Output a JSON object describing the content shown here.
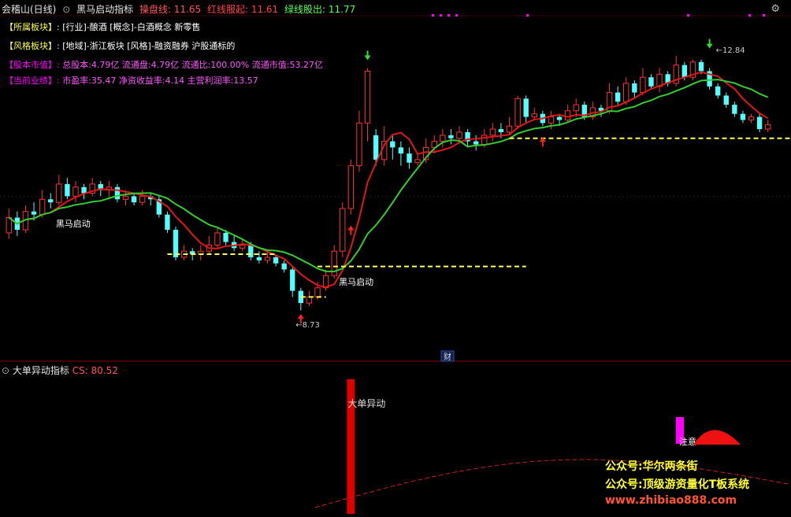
{
  "header": {
    "stock_name": "会稽山(日线)",
    "indicator_name": "黑马启动指标",
    "line1_label": "操盘线: 11.65",
    "line2_label": "红线服起: 11.61",
    "line3_label": "绿线股出: 11.77"
  },
  "info": {
    "row1_tag": "【所属板块】:",
    "row1_text": "[行业]-酿酒 [概念]-白酒概念 新零售",
    "row2_tag": "【风格板块】:",
    "row2_text": "[地域]-浙江板块 [风格]-融资融券 沪股通标的",
    "row3_tag": "【股本市值】:",
    "row3_text": "总股本:4.79亿 流通盘:4.79亿 流通比:100.00% 流通市值:53.27亿",
    "row4_tag": "【当前业绩】:",
    "row4_text": "市盈率:35.47 净资收益率:4.14 主营利润率:13.57"
  },
  "annotations": {
    "signal1": "黑马启动",
    "signal2": "黑马启动",
    "low_price": "8.73",
    "high_price": "12.84",
    "fin_marker": "财"
  },
  "sub_panel": {
    "title": "大单异动指标",
    "cs_label": "CS: 80.52",
    "spike_label": "大单异动",
    "attention_label": "注意"
  },
  "watermarks": {
    "line1": "公众号:华尔两条街",
    "line2": "公众号:顶级游资量化T板系统",
    "line3": "www.zhibiao888.com"
  },
  "colors": {
    "up": "#ff3333",
    "down": "#54ffff",
    "red_line": "#e01818",
    "green_line": "#33cc33",
    "yellow": "#ffff55",
    "magenta": "#ff00ff"
  },
  "chart_data": {
    "type": "candlestick",
    "price_range": [
      8.4,
      13.3
    ],
    "candles": [
      [
        10.0,
        10.25,
        10.4,
        9.9
      ],
      [
        10.25,
        10.05,
        10.35,
        9.95
      ],
      [
        10.05,
        10.35,
        10.45,
        10.0
      ],
      [
        10.35,
        10.3,
        10.5,
        10.2
      ],
      [
        10.3,
        10.55,
        10.7,
        10.25
      ],
      [
        10.55,
        10.5,
        10.65,
        10.4
      ],
      [
        10.5,
        10.8,
        10.95,
        10.45
      ],
      [
        10.8,
        10.6,
        10.9,
        10.55
      ],
      [
        10.6,
        10.75,
        10.85,
        10.5
      ],
      [
        10.75,
        10.65,
        10.8,
        10.55
      ],
      [
        10.65,
        10.8,
        10.9,
        10.6
      ],
      [
        10.8,
        10.7,
        10.85,
        10.6
      ],
      [
        10.7,
        10.75,
        10.85,
        10.55
      ],
      [
        10.75,
        10.55,
        10.8,
        10.5
      ],
      [
        10.55,
        10.6,
        10.7,
        10.45
      ],
      [
        10.6,
        10.5,
        10.65,
        10.45
      ],
      [
        10.5,
        10.6,
        10.7,
        10.45
      ],
      [
        10.6,
        10.55,
        10.65,
        10.45
      ],
      [
        10.55,
        10.3,
        10.6,
        10.25
      ],
      [
        10.3,
        10.05,
        10.35,
        10.0
      ],
      [
        10.05,
        9.6,
        10.1,
        9.55
      ],
      [
        9.6,
        9.7,
        9.8,
        9.55
      ],
      [
        9.7,
        9.65,
        9.75,
        9.55
      ],
      [
        9.65,
        9.7,
        9.8,
        9.55
      ],
      [
        9.7,
        9.8,
        9.95,
        9.65
      ],
      [
        9.8,
        10.0,
        10.1,
        9.75
      ],
      [
        10.0,
        9.85,
        10.05,
        9.8
      ],
      [
        9.85,
        9.75,
        9.95,
        9.7
      ],
      [
        9.75,
        9.8,
        9.9,
        9.7
      ],
      [
        9.8,
        9.6,
        9.85,
        9.55
      ],
      [
        9.6,
        9.55,
        9.7,
        9.5
      ],
      [
        9.55,
        9.6,
        9.7,
        9.5
      ],
      [
        9.6,
        9.5,
        9.65,
        9.45
      ],
      [
        9.5,
        9.4,
        9.55,
        9.35
      ],
      [
        9.4,
        9.05,
        9.45,
        8.95
      ],
      [
        9.05,
        8.85,
        9.1,
        8.73
      ],
      [
        8.85,
        8.95,
        9.05,
        8.8
      ],
      [
        8.95,
        9.1,
        9.2,
        8.9
      ],
      [
        9.1,
        9.3,
        9.4,
        9.05
      ],
      [
        9.3,
        9.7,
        9.8,
        9.25
      ],
      [
        9.7,
        10.4,
        10.5,
        9.6
      ],
      [
        10.4,
        11.1,
        11.2,
        10.3
      ],
      [
        11.1,
        11.8,
        12.0,
        11.0
      ],
      [
        11.8,
        12.65,
        12.7,
        11.5
      ],
      [
        11.6,
        11.2,
        11.7,
        11.1
      ],
      [
        11.2,
        11.5,
        11.75,
        11.1
      ],
      [
        11.5,
        11.4,
        11.6,
        11.2
      ],
      [
        11.4,
        11.3,
        11.5,
        11.1
      ],
      [
        11.3,
        11.15,
        11.4,
        11.05
      ],
      [
        11.15,
        11.2,
        11.3,
        11.1
      ],
      [
        11.2,
        11.4,
        11.55,
        11.15
      ],
      [
        11.4,
        11.5,
        11.6,
        11.3
      ],
      [
        11.5,
        11.6,
        11.7,
        11.4
      ],
      [
        11.6,
        11.55,
        11.7,
        11.45
      ],
      [
        11.55,
        11.65,
        11.75,
        11.45
      ],
      [
        11.65,
        11.5,
        11.7,
        11.4
      ],
      [
        11.5,
        11.45,
        11.6,
        11.35
      ],
      [
        11.45,
        11.6,
        11.7,
        11.4
      ],
      [
        11.6,
        11.7,
        11.8,
        11.5
      ],
      [
        11.7,
        11.65,
        11.8,
        11.55
      ],
      [
        11.65,
        11.75,
        11.9,
        11.6
      ],
      [
        11.75,
        12.2,
        12.25,
        11.7
      ],
      [
        12.2,
        11.9,
        12.25,
        11.8
      ],
      [
        11.9,
        11.95,
        12.05,
        11.85
      ],
      [
        11.95,
        11.8,
        12.0,
        11.75
      ],
      [
        11.8,
        11.9,
        12.0,
        11.7
      ],
      [
        11.9,
        11.85,
        11.95,
        11.75
      ],
      [
        11.85,
        12.0,
        12.1,
        11.8
      ],
      [
        12.0,
        12.1,
        12.2,
        11.9
      ],
      [
        12.1,
        11.9,
        12.15,
        11.85
      ],
      [
        11.9,
        12.05,
        12.15,
        11.85
      ],
      [
        12.05,
        12.0,
        12.1,
        11.9
      ],
      [
        12.0,
        12.3,
        12.45,
        11.95
      ],
      [
        12.3,
        12.15,
        12.4,
        12.1
      ],
      [
        12.15,
        12.45,
        12.55,
        12.1
      ],
      [
        12.45,
        12.3,
        12.5,
        12.2
      ],
      [
        12.3,
        12.55,
        12.7,
        12.25
      ],
      [
        12.55,
        12.4,
        12.6,
        12.35
      ],
      [
        12.4,
        12.6,
        12.7,
        12.3
      ],
      [
        12.6,
        12.45,
        12.65,
        12.4
      ],
      [
        12.45,
        12.75,
        12.9,
        12.4
      ],
      [
        12.75,
        12.55,
        12.8,
        12.5
      ],
      [
        12.55,
        12.8,
        12.84,
        12.5
      ],
      [
        12.8,
        12.65,
        12.84,
        12.6
      ],
      [
        12.65,
        12.4,
        12.7,
        12.35
      ],
      [
        12.4,
        12.25,
        12.45,
        12.2
      ],
      [
        12.25,
        12.1,
        12.3,
        12.05
      ],
      [
        12.1,
        11.95,
        12.15,
        11.9
      ],
      [
        11.95,
        11.85,
        12.0,
        11.8
      ],
      [
        11.85,
        11.9,
        11.95,
        11.8
      ],
      [
        11.9,
        11.7,
        11.95,
        11.65
      ],
      [
        11.7,
        11.77,
        11.85,
        11.65
      ]
    ]
  }
}
